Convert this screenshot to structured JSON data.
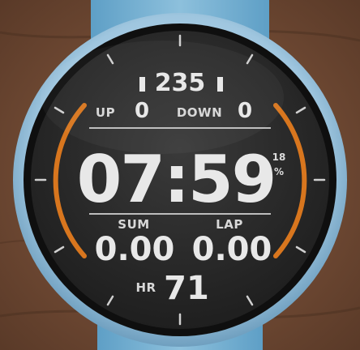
{
  "watch": {
    "metrics": {
      "steps": "235",
      "up_label": "UP",
      "up_value": "0",
      "down_label": "DOWN",
      "down_value": "0",
      "time": "07:59",
      "battery_value": "18",
      "battery_unit": "%",
      "sum_label": "SUM",
      "sum_value": "0.00",
      "lap_label": "LAP",
      "lap_value": "0.00",
      "hr_label": "HR",
      "hr_value": "71"
    }
  },
  "colors": {
    "background_wood": "#6e4a35",
    "strap": "#7fb8d8",
    "bezel": "#9fc6df",
    "dial": "#2a2a2a",
    "arc_accent": "#d8761e",
    "text": "#e8e8e8"
  }
}
